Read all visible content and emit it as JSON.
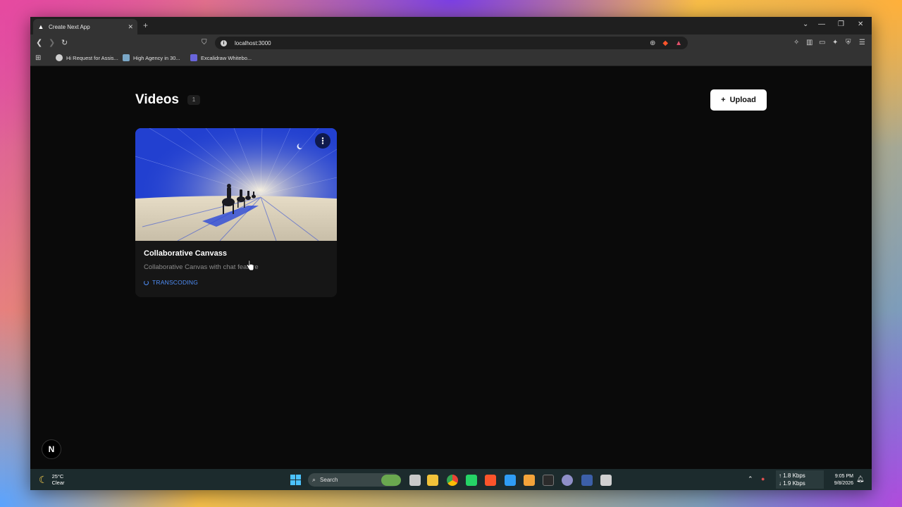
{
  "browser": {
    "tab_title": "Create Next App",
    "url": "localhost:3000",
    "bookmarks": [
      {
        "label": "Hi Request for Assis...",
        "color": "#cfcfcf"
      },
      {
        "label": "High Agency in 30...",
        "color": "#7aa7c7"
      },
      {
        "label": "Excalidraw Whitebo...",
        "color": "#6965db"
      }
    ]
  },
  "page": {
    "title": "Videos",
    "count": "1",
    "upload_label": "Upload",
    "upload_icon": "+",
    "videos": [
      {
        "title": "Collaborative Canvass",
        "description": "Collaborative Canvas with chat feature",
        "status": "TRANSCODING",
        "status_color": "#4f8ef7"
      }
    ],
    "next_badge": "N"
  },
  "taskbar": {
    "weather_temp": "25°C",
    "weather_desc": "Clear",
    "search_placeholder": "Search",
    "net_up": "↑ 1.8 Kbps",
    "net_down": "↓ 1.9 Kbps",
    "time": "9:05 PM",
    "date": "9/8/2026"
  }
}
